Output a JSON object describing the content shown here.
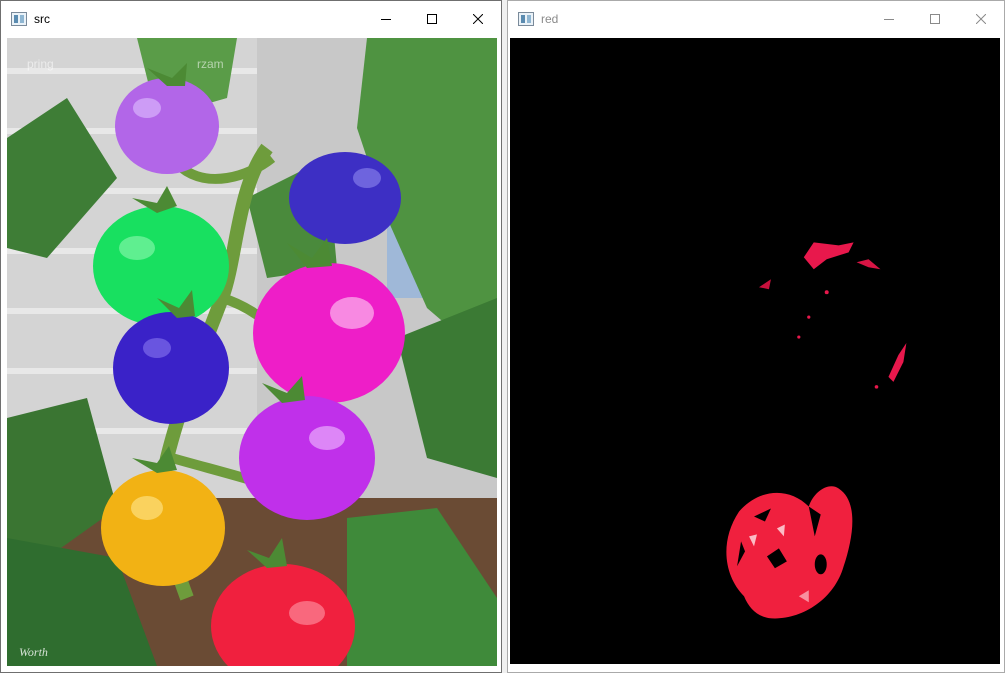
{
  "windows": {
    "src": {
      "title": "src"
    },
    "red": {
      "title": "red"
    }
  },
  "icons": {
    "app": "opencv-window-icon",
    "minimize": "minimize-icon",
    "maximize": "maximize-icon",
    "close": "close-icon"
  },
  "watermark": {
    "left": "pring",
    "right": "rzam",
    "signature": "Worth"
  },
  "colors": {
    "background": "#000000",
    "purple_tomato": "#b266e8",
    "blue_tomato": "#3d2fc4",
    "green_tomato": "#18e060",
    "magenta_tomato": "#ee1ec8",
    "violet_tomato": "#c030ea",
    "yellow_tomato": "#f2b214",
    "red_tomato": "#f0203e",
    "leaf": "#3f8a3a"
  }
}
